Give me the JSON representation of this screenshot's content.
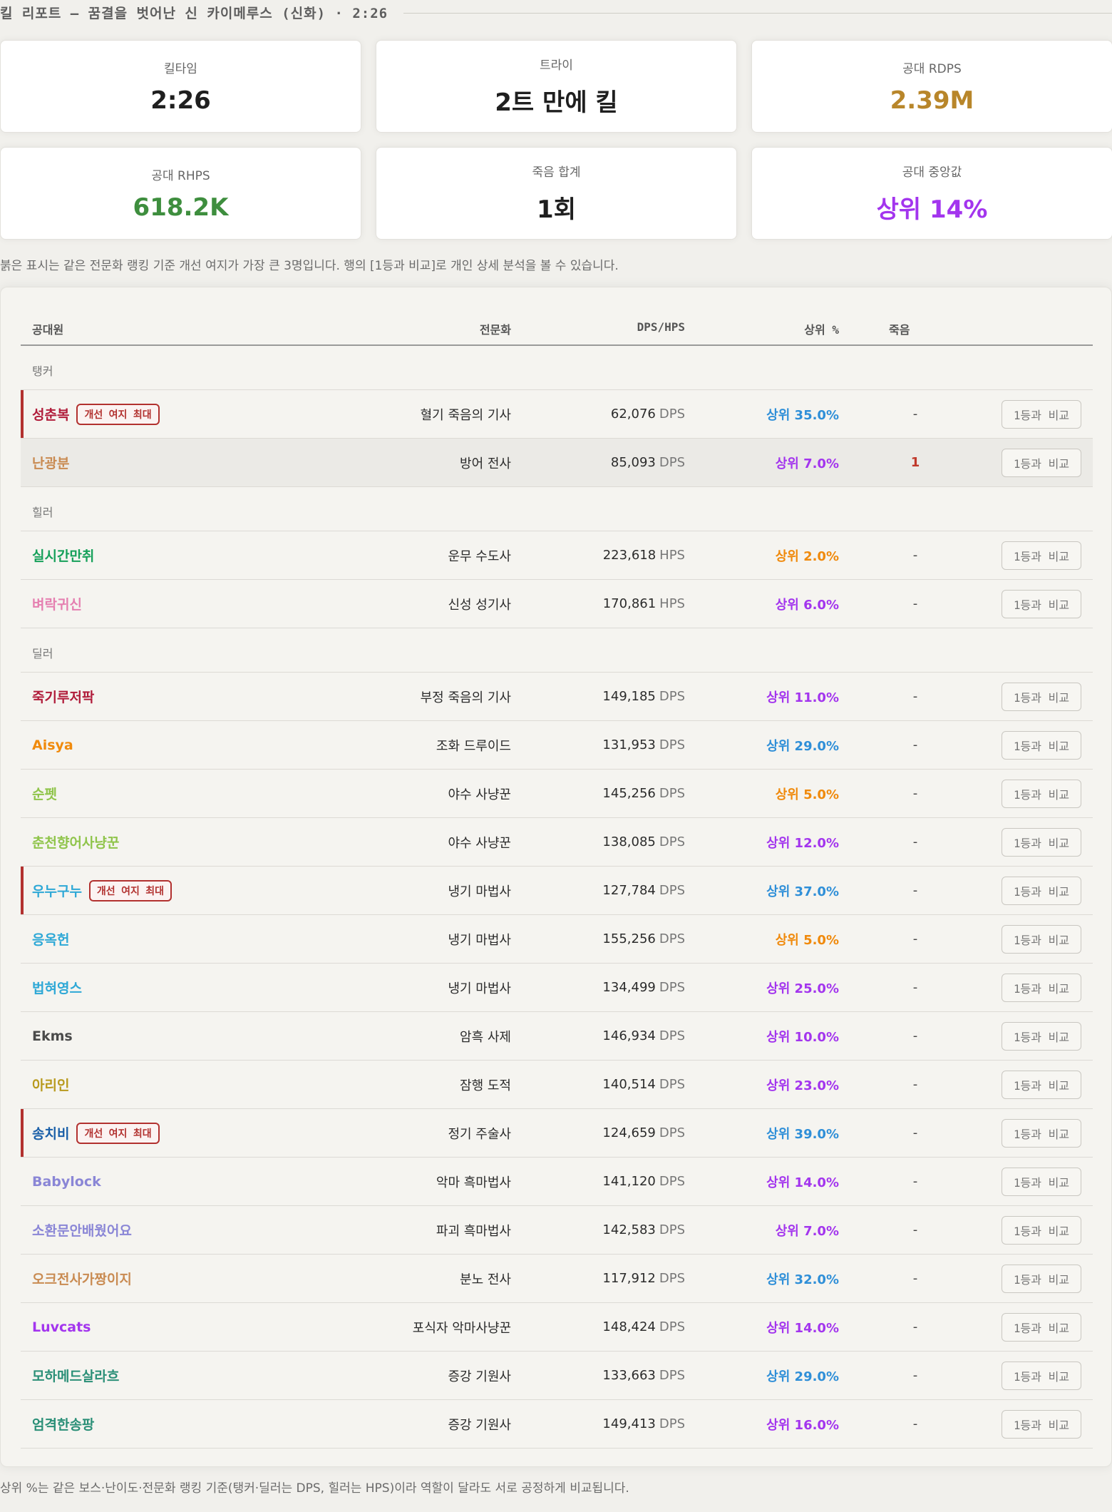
{
  "header": {
    "title": "킬 리포트 — 꿈결을 벗어난 신 카이메루스 (신화) · 2:26"
  },
  "colors": {
    "flag": "#b2312f",
    "rdps": "#b8862a",
    "rhps": "#3e8e3e",
    "median": "#a335ee"
  },
  "stats": [
    {
      "label": "킬타임",
      "value": "2:26",
      "color": "#1f1f1f"
    },
    {
      "label": "트라이",
      "value": "2트 만에 킬",
      "color": "#1f1f1f"
    },
    {
      "label": "공대 RDPS",
      "value": "2.39M",
      "color": "#b8862a"
    },
    {
      "label": "공대 RHPS",
      "value": "618.2K",
      "color": "#3e8e3e"
    },
    {
      "label": "죽음 합계",
      "value": "1회",
      "color": "#1f1f1f"
    },
    {
      "label": "공대 중앙값",
      "value": "상위 14%",
      "color": "#a335ee"
    }
  ],
  "note_top": "붉은 표시는 같은 전문화 랭킹 기준 개선 여지가 가장 큰 3명입니다. 행의 [1등과 비교]로 개인 상세 분석을 볼 수 있습니다.",
  "table": {
    "headers": {
      "member": "공대원",
      "spec": "전문화",
      "amount": "DPS/HPS",
      "percentile": "상위 %",
      "deaths": "죽음"
    },
    "compare_label": "1등과 비교",
    "flag_label": "개선 여지 최대",
    "groups": [
      {
        "label": "탱커",
        "rows": [
          {
            "name": "성춘복",
            "name_color": "#b01c3a",
            "flagged": true,
            "alt": false,
            "spec": "혈기 죽음의 기사",
            "amount": "62,076",
            "unit": "DPS",
            "pct": "상위 35.0%",
            "pct_color": "#2f8fd8",
            "deaths": "-"
          },
          {
            "name": "난광분",
            "name_color": "#c98b52",
            "flagged": false,
            "alt": true,
            "spec": "방어 전사",
            "amount": "85,093",
            "unit": "DPS",
            "pct": "상위 7.0%",
            "pct_color": "#a335ee",
            "deaths": "1"
          }
        ]
      },
      {
        "label": "힐러",
        "rows": [
          {
            "name": "실시간만취",
            "name_color": "#16a05a",
            "flagged": false,
            "alt": false,
            "spec": "운무 수도사",
            "amount": "223,618",
            "unit": "HPS",
            "pct": "상위 2.0%",
            "pct_color": "#f08a0c",
            "deaths": "-"
          },
          {
            "name": "벼락귀신",
            "name_color": "#e57fb0",
            "flagged": false,
            "alt": false,
            "spec": "신성 성기사",
            "amount": "170,861",
            "unit": "HPS",
            "pct": "상위 6.0%",
            "pct_color": "#a335ee",
            "deaths": "-"
          }
        ]
      },
      {
        "label": "딜러",
        "rows": [
          {
            "name": "죽기루저팍",
            "name_color": "#b01c3a",
            "flagged": false,
            "alt": false,
            "spec": "부정 죽음의 기사",
            "amount": "149,185",
            "unit": "DPS",
            "pct": "상위 11.0%",
            "pct_color": "#a335ee",
            "deaths": "-"
          },
          {
            "name": "Aisya",
            "name_color": "#f08a0c",
            "flagged": false,
            "alt": false,
            "spec": "조화 드루이드",
            "amount": "131,953",
            "unit": "DPS",
            "pct": "상위 29.0%",
            "pct_color": "#2f8fd8",
            "deaths": "-"
          },
          {
            "name": "순펫",
            "name_color": "#8fc44a",
            "flagged": false,
            "alt": false,
            "spec": "야수 사냥꾼",
            "amount": "145,256",
            "unit": "DPS",
            "pct": "상위 5.0%",
            "pct_color": "#f08a0c",
            "deaths": "-"
          },
          {
            "name": "춘천향어사냥꾼",
            "name_color": "#8fc44a",
            "flagged": false,
            "alt": false,
            "spec": "야수 사냥꾼",
            "amount": "138,085",
            "unit": "DPS",
            "pct": "상위 12.0%",
            "pct_color": "#a335ee",
            "deaths": "-"
          },
          {
            "name": "우누구누",
            "name_color": "#2ea8d6",
            "flagged": true,
            "alt": false,
            "spec": "냉기 마법사",
            "amount": "127,784",
            "unit": "DPS",
            "pct": "상위 37.0%",
            "pct_color": "#2f8fd8",
            "deaths": "-"
          },
          {
            "name": "응옥헌",
            "name_color": "#2ea8d6",
            "flagged": false,
            "alt": false,
            "spec": "냉기 마법사",
            "amount": "155,256",
            "unit": "DPS",
            "pct": "상위 5.0%",
            "pct_color": "#f08a0c",
            "deaths": "-"
          },
          {
            "name": "법혀영스",
            "name_color": "#2ea8d6",
            "flagged": false,
            "alt": false,
            "spec": "냉기 마법사",
            "amount": "134,499",
            "unit": "DPS",
            "pct": "상위 25.0%",
            "pct_color": "#a335ee",
            "deaths": "-"
          },
          {
            "name": "Ekms",
            "name_color": "#4a4a4a",
            "flagged": false,
            "alt": false,
            "spec": "암흑 사제",
            "amount": "146,934",
            "unit": "DPS",
            "pct": "상위 10.0%",
            "pct_color": "#a335ee",
            "deaths": "-"
          },
          {
            "name": "아리인",
            "name_color": "#b89a1e",
            "flagged": false,
            "alt": false,
            "spec": "잠행 도적",
            "amount": "140,514",
            "unit": "DPS",
            "pct": "상위 23.0%",
            "pct_color": "#a335ee",
            "deaths": "-"
          },
          {
            "name": "송치비",
            "name_color": "#1a5fa8",
            "flagged": true,
            "alt": false,
            "spec": "정기 주술사",
            "amount": "124,659",
            "unit": "DPS",
            "pct": "상위 39.0%",
            "pct_color": "#2f8fd8",
            "deaths": "-"
          },
          {
            "name": "Babylock",
            "name_color": "#8a86d6",
            "flagged": false,
            "alt": false,
            "spec": "악마 흑마법사",
            "amount": "141,120",
            "unit": "DPS",
            "pct": "상위 14.0%",
            "pct_color": "#a335ee",
            "deaths": "-"
          },
          {
            "name": "소환문안배웠어요",
            "name_color": "#8a86d6",
            "flagged": false,
            "alt": false,
            "spec": "파괴 흑마법사",
            "amount": "142,583",
            "unit": "DPS",
            "pct": "상위 7.0%",
            "pct_color": "#a335ee",
            "deaths": "-"
          },
          {
            "name": "오크전사가짱이지",
            "name_color": "#c98b52",
            "flagged": false,
            "alt": false,
            "spec": "분노 전사",
            "amount": "117,912",
            "unit": "DPS",
            "pct": "상위 32.0%",
            "pct_color": "#2f8fd8",
            "deaths": "-"
          },
          {
            "name": "Luvcats",
            "name_color": "#a335ee",
            "flagged": false,
            "alt": false,
            "spec": "포식자 악마사냥꾼",
            "amount": "148,424",
            "unit": "DPS",
            "pct": "상위 14.0%",
            "pct_color": "#a335ee",
            "deaths": "-"
          },
          {
            "name": "모하메드살라흐",
            "name_color": "#2a8f77",
            "flagged": false,
            "alt": false,
            "spec": "증강 기원사",
            "amount": "133,663",
            "unit": "DPS",
            "pct": "상위 29.0%",
            "pct_color": "#2f8fd8",
            "deaths": "-"
          },
          {
            "name": "엄격한송팡",
            "name_color": "#2a8f77",
            "flagged": false,
            "alt": false,
            "spec": "증강 기원사",
            "amount": "149,413",
            "unit": "DPS",
            "pct": "상위 16.0%",
            "pct_color": "#a335ee",
            "deaths": "-"
          }
        ]
      }
    ]
  },
  "note_bottom": "상위 %는 같은 보스·난이도·전문화 랭킹 기준(탱커·딜러는 DPS, 힐러는 HPS)이라 역할이 달라도 서로 공정하게 비교됩니다."
}
